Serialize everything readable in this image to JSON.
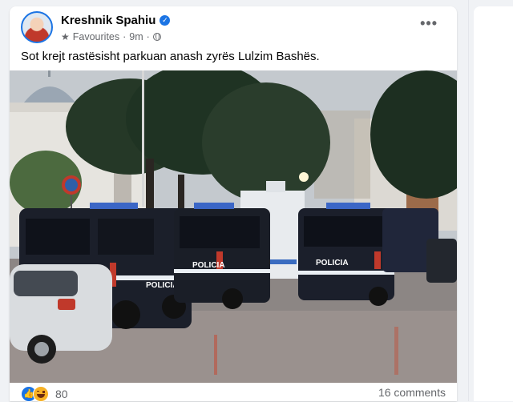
{
  "post": {
    "author": "Kreshnik Spahiu",
    "audience_label": "Favourites",
    "separator": "·",
    "time": "9m",
    "text": "Sot krejt rastësisht parkuan anash zyrës Lulzim Bashës.",
    "more_icon": "more-horizontal-icon"
  },
  "photo": {
    "van_label": "POLICIA"
  },
  "engagement": {
    "reaction_icons": [
      "like-icon",
      "haha-icon"
    ],
    "reaction_count": "80",
    "comments": "16 comments"
  },
  "colors": {
    "accent": "#1b74e4",
    "text_primary": "#050505",
    "text_secondary": "#65676b",
    "background": "#f0f2f5"
  }
}
